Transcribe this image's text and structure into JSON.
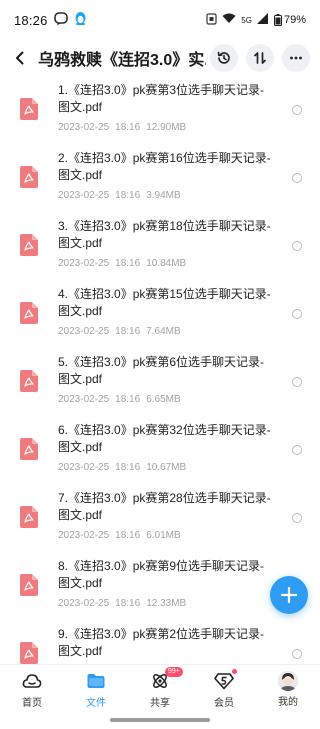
{
  "status_bar": {
    "time": "18:26",
    "network": "5G",
    "battery": "79%"
  },
  "header": {
    "title": "乌鸦救赎《连招3.0》实..."
  },
  "files": [
    {
      "name": "1.《连招3.0》pk赛第3位选手聊天记录-图文.pdf",
      "date": "2023-02-25",
      "time": "18:16",
      "size": "12.90MB"
    },
    {
      "name": "2.《连招3.0》pk赛第16位选手聊天记录-图文.pdf",
      "date": "2023-02-25",
      "time": "18:16",
      "size": "3.94MB"
    },
    {
      "name": "3.《连招3.0》pk赛第18位选手聊天记录-图文.pdf",
      "date": "2023-02-25",
      "time": "18:16",
      "size": "10.84MB"
    },
    {
      "name": "4.《连招3.0》pk赛第15位选手聊天记录-图文.pdf",
      "date": "2023-02-25",
      "time": "18:16",
      "size": "7.64MB"
    },
    {
      "name": "5.《连招3.0》pk赛第6位选手聊天记录-图文.pdf",
      "date": "2023-02-25",
      "time": "18:16",
      "size": "6.65MB"
    },
    {
      "name": "6.《连招3.0》pk赛第32位选手聊天记录-图文.pdf",
      "date": "2023-02-25",
      "time": "18:16",
      "size": "10.67MB"
    },
    {
      "name": "7.《连招3.0》pk赛第28位选手聊天记录-图文.pdf",
      "date": "2023-02-25",
      "time": "18:16",
      "size": "6.01MB"
    },
    {
      "name": "8.《连招3.0》pk赛第9位选手聊天记录-图文.pdf",
      "date": "2023-02-25",
      "time": "18:16",
      "size": "12.33MB"
    },
    {
      "name": "9.《连招3.0》pk赛第2位选手聊天记录-图文.pdf",
      "date": "",
      "time": "",
      "size": ""
    }
  ],
  "bottom_nav": {
    "items": [
      {
        "label": "首页",
        "icon": "cloud-icon"
      },
      {
        "label": "文件",
        "icon": "folder-icon"
      },
      {
        "label": "共享",
        "icon": "share-icon",
        "badge": "99+"
      },
      {
        "label": "会员",
        "icon": "vip-icon"
      },
      {
        "label": "我的",
        "icon": "avatar"
      }
    ],
    "active_index": 1
  },
  "colors": {
    "accent": "#2f9cf3",
    "pdf_icon": "#f07b7e",
    "badge": "#ff4d6d"
  }
}
